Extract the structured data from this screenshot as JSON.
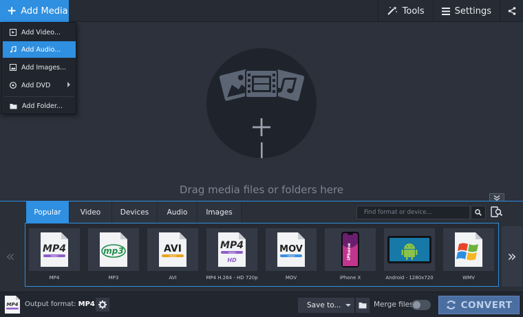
{
  "toolbar": {
    "add_media_label": "Add Media",
    "tools_label": "Tools",
    "settings_label": "Settings"
  },
  "add_menu": {
    "items": [
      {
        "label": "Add Video...",
        "icon": "film-icon"
      },
      {
        "label": "Add Audio...",
        "icon": "music-note-icon",
        "active": true
      },
      {
        "label": "Add Images...",
        "icon": "image-icon"
      },
      {
        "label": "Add DVD",
        "icon": "disc-icon",
        "has_submenu": true
      },
      {
        "label": "Add Folder...",
        "icon": "folder-icon"
      }
    ]
  },
  "dropzone": {
    "text": "Drag media files or folders here"
  },
  "format_panel": {
    "tabs": [
      {
        "label": "Popular",
        "active": true
      },
      {
        "label": "Video"
      },
      {
        "label": "Devices"
      },
      {
        "label": "Audio"
      },
      {
        "label": "Images"
      }
    ],
    "search_placeholder": "Find format or device...",
    "formats": [
      {
        "label": "MP4",
        "badge": "MP4"
      },
      {
        "label": "MP3",
        "badge": "mp3"
      },
      {
        "label": "AVI",
        "badge": "AVI"
      },
      {
        "label": "MP4 H.264 - HD 720p",
        "badge": "MP4",
        "sub_badge": "HD"
      },
      {
        "label": "MOV",
        "badge": "MOV"
      },
      {
        "label": "iPhone X",
        "badge": "iPhone"
      },
      {
        "label": "Android - 1280x720",
        "badge": ""
      },
      {
        "label": "WMV",
        "badge": ""
      }
    ]
  },
  "bottom_bar": {
    "output_label": "Output format:",
    "output_value": "MP4",
    "save_to_label": "Save to...",
    "merge_label": "Merge files:",
    "merge_enabled": false,
    "convert_label": "CONVERT"
  },
  "colors": {
    "accent": "#2f8fe0",
    "background": "#2c313c",
    "convert_button": "#4b6ea0"
  }
}
